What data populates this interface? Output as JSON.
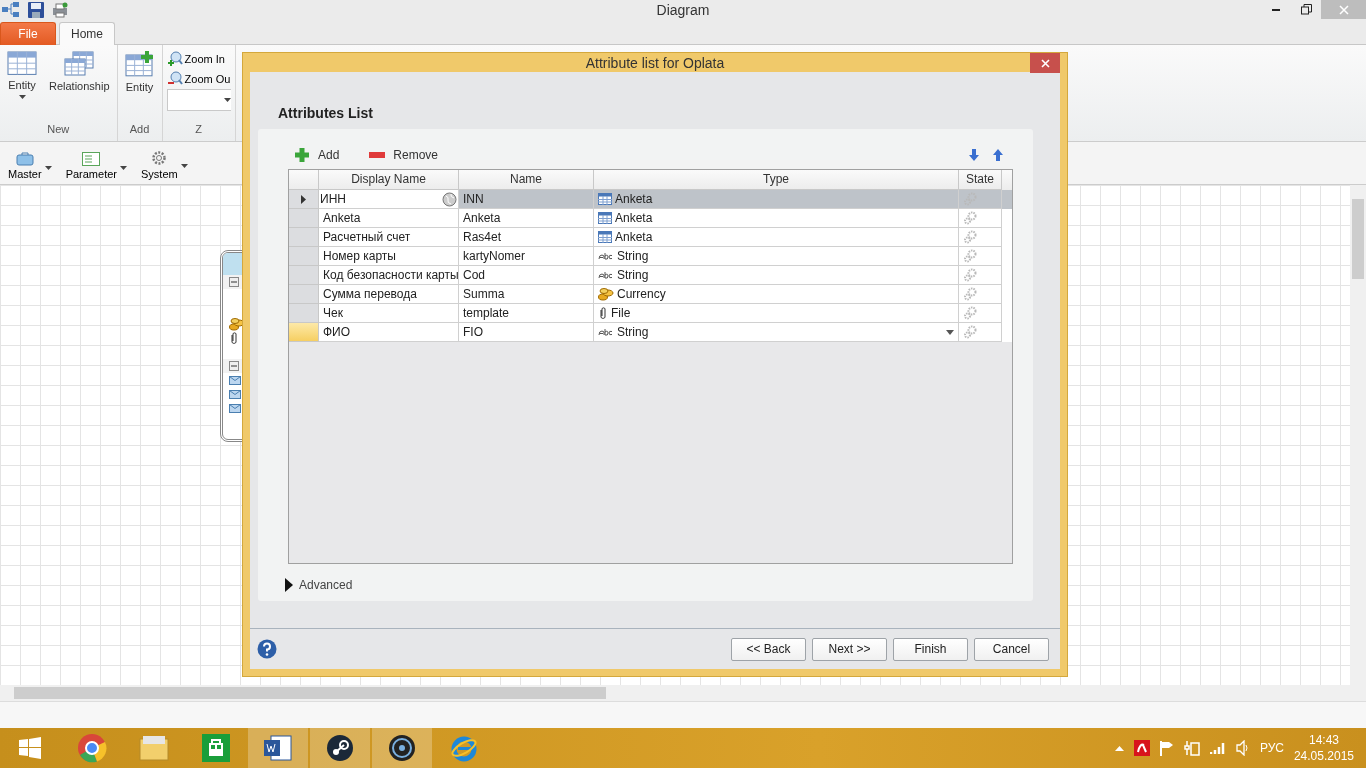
{
  "window": {
    "title": "Diagram"
  },
  "ribbon_tabs": [
    {
      "label": "File",
      "kind": "file",
      "selected": false
    },
    {
      "label": "Home",
      "kind": "tab",
      "selected": true
    }
  ],
  "ribbon_groups": [
    {
      "label": "New",
      "buttons": [
        {
          "label": "Entity",
          "kind": "table",
          "dropdown": true
        },
        {
          "label": "Relationship",
          "kind": "tables",
          "dropdown": false
        }
      ]
    },
    {
      "label": "Add",
      "buttons": [
        {
          "label": "Entity",
          "kind": "table-add",
          "dropdown": false
        }
      ]
    },
    {
      "label": "Z",
      "zoom": [
        {
          "label": "Zoom In",
          "kind": "in"
        },
        {
          "label": "Zoom Ou",
          "kind": "out"
        }
      ]
    }
  ],
  "toolbar": [
    {
      "label": "Master",
      "kind": "case"
    },
    {
      "label": "Parameter",
      "kind": "params"
    },
    {
      "label": "System",
      "kind": "gear"
    }
  ],
  "node": {
    "rows": [
      {
        "kind": "group"
      },
      {
        "kind": "blank"
      },
      {
        "kind": "blank"
      },
      {
        "kind": "coins"
      },
      {
        "kind": "clip"
      },
      {
        "kind": "blank"
      },
      {
        "kind": "group"
      },
      {
        "kind": "mail"
      },
      {
        "kind": "mail"
      },
      {
        "kind": "mail"
      }
    ]
  },
  "dialog": {
    "title": "Attribute list for Oplata",
    "heading": "Attributes List",
    "actions": [
      {
        "label": "Add",
        "kind": "add"
      },
      {
        "label": "Remove",
        "kind": "remove"
      }
    ],
    "columns": [
      "Display Name",
      "Name",
      "Type",
      "State"
    ],
    "rows": [
      {
        "display": "ИНН",
        "name": "INN",
        "type": "Anketa",
        "kind": "table",
        "selected": true,
        "editing": true
      },
      {
        "display": "Anketa",
        "name": "Anketa",
        "type": "Anketa",
        "kind": "table",
        "selected": false,
        "editing": false
      },
      {
        "display": "Расчетный счет",
        "name": "Ras4et",
        "type": "Anketa",
        "kind": "table",
        "selected": false,
        "editing": false
      },
      {
        "display": "Номер карты",
        "name": "kartyNomer",
        "type": "String",
        "kind": "string",
        "selected": false,
        "editing": false
      },
      {
        "display": "Код безопасности карты",
        "name": "Cod",
        "type": "String",
        "kind": "string",
        "selected": false,
        "editing": false
      },
      {
        "display": "Сумма перевода",
        "name": "Summa",
        "type": "Currency",
        "kind": "currency",
        "selected": false,
        "editing": false
      },
      {
        "display": "Чек",
        "name": "template",
        "type": "File",
        "kind": "file",
        "selected": false,
        "editing": false
      },
      {
        "display": "ФИО",
        "name": "FIO",
        "type": "String",
        "kind": "string",
        "selected": false,
        "editing": false,
        "new_row": true
      }
    ],
    "advanced": {
      "label": "Advanced",
      "expanded": false
    },
    "buttons": [
      "<< Back",
      "Next >>",
      "Finish",
      "Cancel"
    ]
  },
  "taskbar": {
    "apps": [
      {
        "kind": "chrome"
      },
      {
        "kind": "folder"
      },
      {
        "kind": "store"
      },
      {
        "kind": "word"
      },
      {
        "kind": "steam"
      },
      {
        "kind": "disc"
      },
      {
        "kind": "ie"
      }
    ],
    "language": "РУС",
    "time": "14:43",
    "date": "24.05.2015"
  }
}
